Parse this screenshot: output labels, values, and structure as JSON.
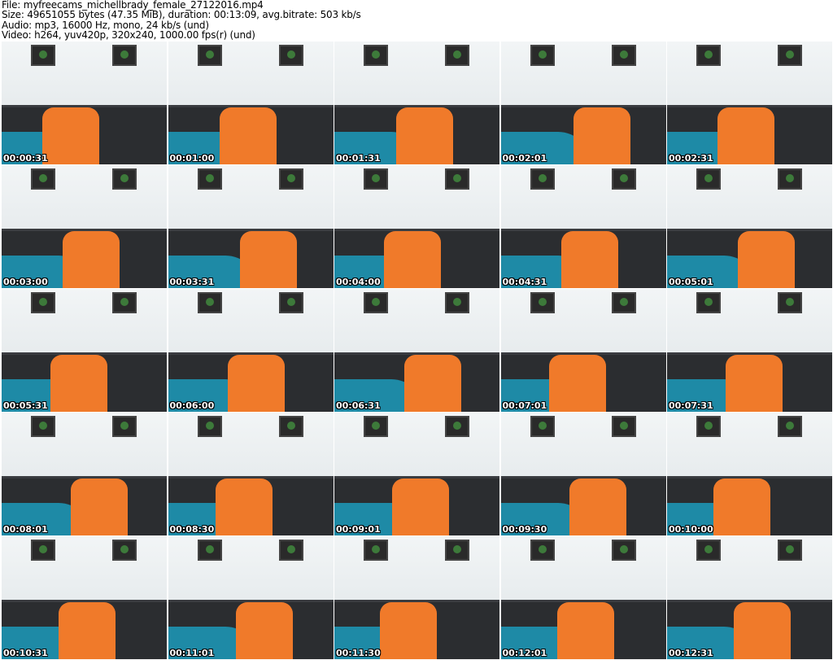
{
  "header": {
    "file": "File: myfreecams_michellbrady_female_27122016.mp4",
    "size": "Size: 49651055 bytes (47.35 MiB), duration: 00:13:09, avg.bitrate: 503 kb/s",
    "audio": "Audio: mp3, 16000 Hz, mono, 24 kb/s (und)",
    "video": "Video: h264, yuv420p, 320x240, 1000.00 fps(r) (und)"
  },
  "thumbnails": [
    "00:00:31",
    "00:01:00",
    "00:01:31",
    "00:02:01",
    "00:02:31",
    "00:03:00",
    "00:03:31",
    "00:04:00",
    "00:04:31",
    "00:05:01",
    "00:05:31",
    "00:06:00",
    "00:06:31",
    "00:07:01",
    "00:07:31",
    "00:08:01",
    "00:08:30",
    "00:09:01",
    "00:09:30",
    "00:10:00",
    "00:10:31",
    "00:11:01",
    "00:11:30",
    "00:12:01",
    "00:12:31"
  ]
}
